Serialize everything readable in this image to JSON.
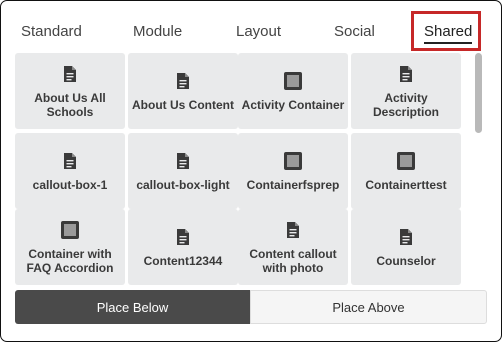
{
  "tabs": [
    {
      "label": "Standard",
      "active": false
    },
    {
      "label": "Module",
      "active": false
    },
    {
      "label": "Layout",
      "active": false
    },
    {
      "label": "Social",
      "active": false
    },
    {
      "label": "Shared",
      "active": true
    }
  ],
  "colors": {
    "highlight": "#c62828",
    "tile_bg": "#e9eaeb",
    "primary_button": "#4a4a4a"
  },
  "tiles": [
    {
      "label": "About Us All Schools",
      "icon": "document-icon"
    },
    {
      "label": "About Us Content",
      "icon": "document-icon"
    },
    {
      "label": "Activity Container",
      "icon": "container-icon"
    },
    {
      "label": "Activity Description",
      "icon": "document-icon"
    },
    {
      "label": "callout-box-1",
      "icon": "document-icon"
    },
    {
      "label": "callout-box-light",
      "icon": "document-icon"
    },
    {
      "label": "Containerfsprep",
      "icon": "container-icon"
    },
    {
      "label": "Containerttest",
      "icon": "container-icon"
    },
    {
      "label": "Container with FAQ Accordion",
      "icon": "container-icon"
    },
    {
      "label": "Content12344",
      "icon": "document-icon"
    },
    {
      "label": "Content callout with photo",
      "icon": "document-icon"
    },
    {
      "label": "Counselor",
      "icon": "document-icon"
    }
  ],
  "actions": {
    "place_below": "Place Below",
    "place_above": "Place Above"
  }
}
